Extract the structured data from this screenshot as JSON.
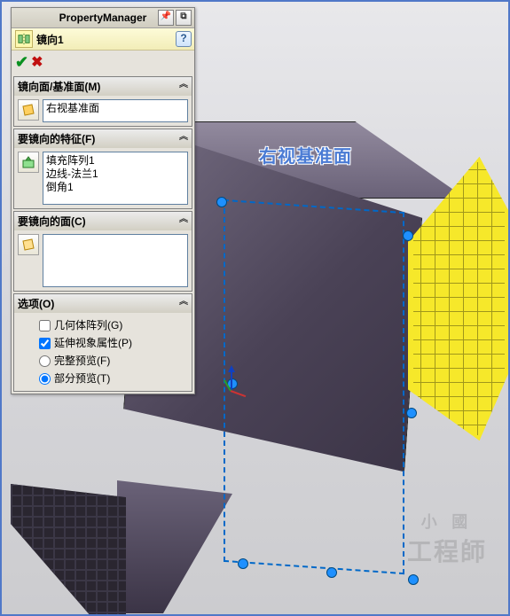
{
  "panel": {
    "title": "PropertyManager",
    "feature_name": "镜向1",
    "sections": {
      "mirror_plane": {
        "header": "镜向面/基准面(M)",
        "value": "右视基准面"
      },
      "features": {
        "header": "要镜向的特征(F)",
        "items": [
          "填充阵列1",
          "边线-法兰1",
          "倒角1"
        ]
      },
      "faces": {
        "header": "要镜向的面(C)"
      },
      "options": {
        "header": "选项(O)",
        "geom_pattern": "几何体阵列(G)",
        "extend_visual": "延伸视象属性(P)",
        "full_preview": "完整预览(F)",
        "partial_preview": "部分预览(T)"
      }
    }
  },
  "viewport": {
    "plane_label": "右视基准面"
  },
  "watermark": {
    "line1": "小 國",
    "line2": "工程師"
  }
}
